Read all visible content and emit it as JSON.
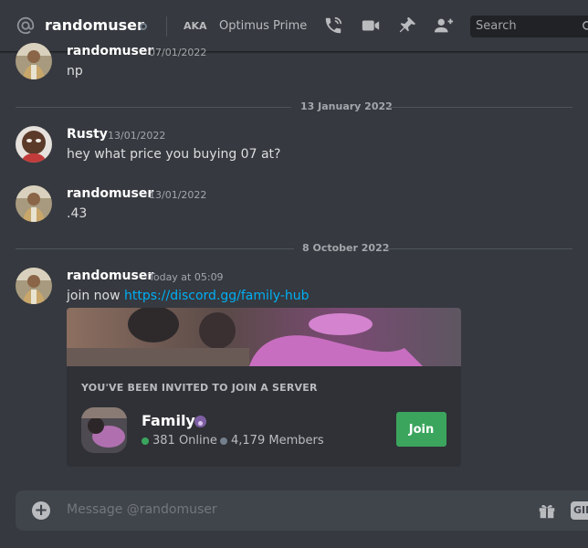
{
  "header": {
    "title": "randomuser",
    "aka_label": "AKA",
    "aka_name": "Optimus Prime",
    "search_placeholder": "Search"
  },
  "messages": [
    {
      "author": "randomuser",
      "timestamp": "07/01/2022",
      "text": "np"
    },
    {
      "author": "Rusty",
      "timestamp": "13/01/2022",
      "text": "hey what price you buying 07 at?"
    },
    {
      "author": "randomuser",
      "timestamp": "13/01/2022",
      "text": ".43"
    },
    {
      "author": "randomuser",
      "timestamp": "Today at 05:09",
      "text_prefix": "join now ",
      "link": "https://discord.gg/family-hub"
    }
  ],
  "date_dividers": [
    "13 January 2022",
    "8 October 2022"
  ],
  "invite": {
    "title": "YOU'VE BEEN INVITED TO JOIN A SERVER",
    "server_name": "Family",
    "online": "381 Online",
    "members": "4,179 Members",
    "join_label": "Join"
  },
  "composer": {
    "placeholder": "Message @randomuser",
    "gif_label": "GIF"
  },
  "colors": {
    "background": "#36393f",
    "link": "#00aff4",
    "join_button": "#3ba55d",
    "online_dot": "#3ba55d",
    "members_dot": "#747f8d"
  },
  "icons": [
    "at-icon",
    "status-icon",
    "phone-icon",
    "video-icon",
    "pin-icon",
    "add-friend-icon",
    "search-icon",
    "add-attachment-icon",
    "gift-icon",
    "partner-badge-icon"
  ]
}
